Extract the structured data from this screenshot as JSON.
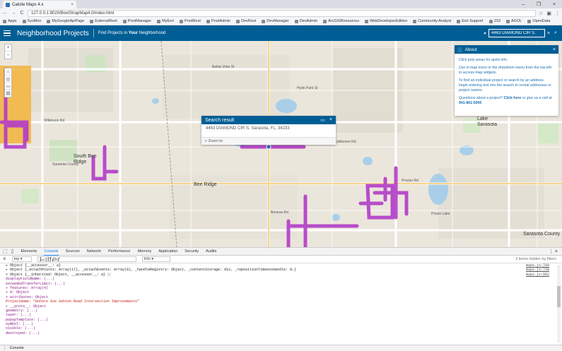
{
  "browser": {
    "tab_title": "Calcite Maps 4.x",
    "tab_close": "×",
    "window_controls": [
      "–",
      "❐",
      "×"
    ],
    "nav": [
      "←",
      "→",
      "C"
    ],
    "url": "127.0.0.1:8020/BootStrapMap4.0/index.html",
    "bookmarks": [
      "Apps",
      "SysMon",
      "MyGoogleApiPage",
      "ExternalRest",
      "ProdManager",
      "MyEsri",
      "ProdRest",
      "ProdAdmin",
      "DevRest",
      "DevManager",
      "DevAdmin",
      "ArcGISResources",
      "WebDeveloperEdition",
      "Community Analyst",
      "Esri Support",
      "JS3",
      "AGOL",
      "OpenData"
    ]
  },
  "app": {
    "title": "Neighborhood Projects",
    "subtitle_prefix": "Find Projects in ",
    "subtitle_bold": "Your",
    "subtitle_suffix": " Neighborhood",
    "search_value": "4463 DIAMOND CIR S.",
    "search_clear": "×",
    "search_icon": "⌕",
    "search_dropdown": "▾"
  },
  "map": {
    "controls_top": [
      "+",
      "−"
    ],
    "controls_side": [
      "⌂",
      "◎",
      "▭",
      "▤"
    ],
    "labels": [
      {
        "text": "Bee Ridge",
        "cls": "big"
      },
      {
        "text": "South Bee Ridge",
        "cls": "big"
      },
      {
        "text": "Lake Sarasota",
        "cls": "big"
      },
      {
        "text": "Wilkinson Rd",
        "cls": ""
      },
      {
        "text": "Proctor Rd",
        "cls": ""
      },
      {
        "text": "Bahia Vista St",
        "cls": ""
      },
      {
        "text": "Sarasota County",
        "cls": ""
      },
      {
        "text": "Hyde Park St",
        "cls": ""
      },
      {
        "text": "Beneva Rd",
        "cls": ""
      },
      {
        "text": "Cattlemen Rd",
        "cls": ""
      },
      {
        "text": "Prison Lake",
        "cls": ""
      },
      {
        "text": "Sarasota County",
        "cls": "big"
      }
    ]
  },
  "popup": {
    "title": "Search result",
    "address": "4463 DIAMOND CIR S, Sarasota, FL, 34233",
    "zoom_label": "Zoom to",
    "icons": [
      "▭",
      "×"
    ]
  },
  "about": {
    "title": "About",
    "p1": "Click poly-areas for quick info.",
    "p2": "Use in map icons or the dropdown menu from the top-left to access map widgets.",
    "p3": "To find an individual project or search by an address, begin entering text into the search to reveal addresses or project names.",
    "p4_prefix": "Questions about a project? ",
    "p4_bold": "Click here",
    "p4_suffix": " or give us a call at",
    "phone": "941-861-5000",
    "close": "×"
  },
  "devtools": {
    "tabs": [
      "Elements",
      "Console",
      "Sources",
      "Network",
      "Performance",
      "Memory",
      "Application",
      "Security",
      "Audits"
    ],
    "active_tab": "Console",
    "context": "top",
    "filter_placeholder": "Filter",
    "level": "Info",
    "hidden_count": "3 items hidden by filters",
    "bottom_tab": "Console",
    "lines": [
      {
        "txt": "▸ Object {__accessor__: a}",
        "src": "maps.js:799"
      },
      {
        "txt": "▸ Object {_attachPoints: Array(17), _attachEvents: Array(0), _handleRegistry: Object, _contentStorage: div, _repositionTimeoutHandle: 8…}",
        "src": "maps.js:738"
      },
      {
        "txt": "▾ Object {__inherited: Object, __accessor__: a} ⓘ",
        "src": "maps.js:802"
      },
      {
        "txt": "    displayFieldName: (...)",
        "src": ""
      },
      {
        "txt": "    exceededTransferLimit: (...)",
        "src": ""
      },
      {
        "txt": "  ▾ features: Array(4)",
        "src": ""
      },
      {
        "txt": "    ▾ 0: Object",
        "src": ""
      },
      {
        "txt": "      ▾ attributes: Object",
        "src": ""
      },
      {
        "txt": "          ProjectName: \"Honore Ave Ashton Road Intersection Improvements\"",
        "src": ""
      },
      {
        "txt": "        ▸ __proto__: Object",
        "src": ""
      },
      {
        "txt": "        geometry: (...)",
        "src": ""
      },
      {
        "txt": "        layer: (...)",
        "src": ""
      },
      {
        "txt": "        popupTemplate: (...)",
        "src": ""
      },
      {
        "txt": "        symbol: (...)",
        "src": ""
      },
      {
        "txt": "        visible: (...)",
        "src": ""
      },
      {
        "txt": "        destroyed: (...)",
        "src": ""
      }
    ]
  }
}
